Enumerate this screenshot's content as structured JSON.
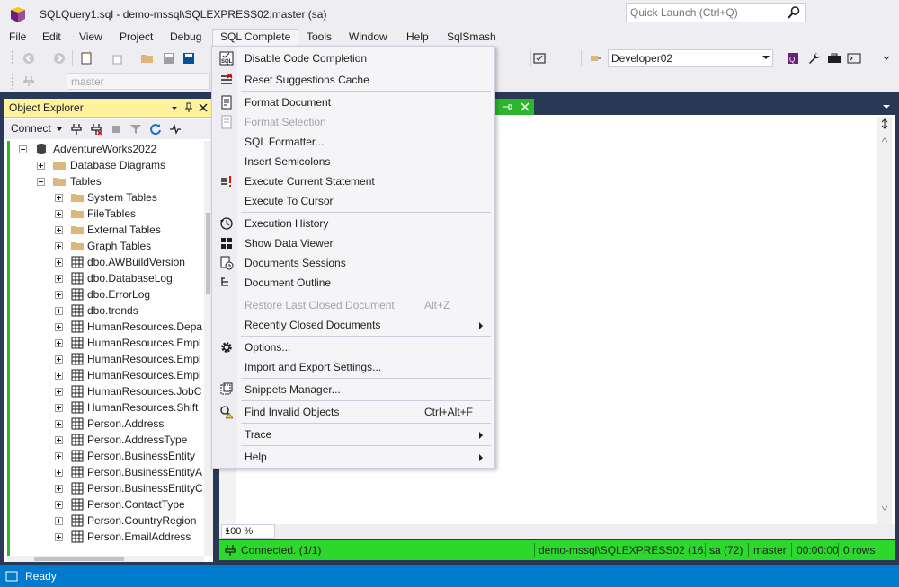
{
  "window": {
    "title": "SQLQuery1.sql - demo-mssql\\SQLEXPRESS02.master (sa)",
    "quick_launch_placeholder": "Quick Launch (Ctrl+Q)"
  },
  "menubar": {
    "items": [
      "File",
      "Edit",
      "View",
      "Project",
      "Debug",
      "SQL Complete",
      "Tools",
      "Window",
      "Help",
      "SqlSmash"
    ]
  },
  "toolbar": {
    "server_value": "Developer02",
    "database_value": "master"
  },
  "object_explorer": {
    "title": "Object Explorer",
    "connect_label": "Connect",
    "tree": [
      "AdventureWorks2022",
      "Database Diagrams",
      "Tables",
      "System Tables",
      "FileTables",
      "External Tables",
      "Graph Tables",
      "dbo.AWBuildVersion",
      "dbo.DatabaseLog",
      "dbo.ErrorLog",
      "dbo.trends",
      "HumanResources.Depa",
      "HumanResources.Empl",
      "HumanResources.Empl",
      "HumanResources.Empl",
      "HumanResources.JobC",
      "HumanResources.Shift",
      "Person.Address",
      "Person.AddressType",
      "Person.BusinessEntity",
      "Person.BusinessEntityA",
      "Person.BusinessEntityC",
      "Person.ContactType",
      "Person.CountryRegion",
      "Person.EmailAddress"
    ]
  },
  "sql_complete_menu": {
    "items": [
      {
        "label": "Disable Code Completion",
        "icon": "sql-icon",
        "shortcut": "",
        "submenu": false,
        "disabled": false
      },
      {
        "label": "Reset Suggestions Cache",
        "icon": "reset-cache-icon",
        "shortcut": "",
        "submenu": false,
        "disabled": false
      },
      {
        "label": "Format Document",
        "icon": "format-document-icon",
        "shortcut": "",
        "submenu": false,
        "disabled": false
      },
      {
        "label": "Format Selection",
        "icon": "format-selection-icon",
        "shortcut": "",
        "submenu": false,
        "disabled": true
      },
      {
        "label": "SQL Formatter...",
        "icon": "",
        "shortcut": "",
        "submenu": false,
        "disabled": false
      },
      {
        "label": "Insert Semicolons",
        "icon": "",
        "shortcut": "",
        "submenu": false,
        "disabled": false
      },
      {
        "label": "Execute Current Statement",
        "icon": "execute-statement-icon",
        "shortcut": "",
        "submenu": false,
        "disabled": false
      },
      {
        "label": "Execute To Cursor",
        "icon": "",
        "shortcut": "",
        "submenu": false,
        "disabled": false
      },
      {
        "label": "Execution History",
        "icon": "history-icon",
        "shortcut": "",
        "submenu": false,
        "disabled": false
      },
      {
        "label": "Show Data Viewer",
        "icon": "data-viewer-icon",
        "shortcut": "",
        "submenu": false,
        "disabled": false
      },
      {
        "label": "Documents Sessions",
        "icon": "sessions-icon",
        "shortcut": "",
        "submenu": false,
        "disabled": false
      },
      {
        "label": "Document Outline",
        "icon": "outline-icon",
        "shortcut": "",
        "submenu": false,
        "disabled": false
      },
      {
        "label": "Restore Last Closed Document",
        "icon": "",
        "shortcut": "Alt+Z",
        "submenu": false,
        "disabled": true
      },
      {
        "label": "Recently Closed Documents",
        "icon": "",
        "shortcut": "",
        "submenu": true,
        "disabled": false
      },
      {
        "label": "Options...",
        "icon": "gear-icon",
        "shortcut": "",
        "submenu": false,
        "disabled": false
      },
      {
        "label": "Import and Export Settings...",
        "icon": "",
        "shortcut": "",
        "submenu": false,
        "disabled": false
      },
      {
        "label": "Snippets Manager...",
        "icon": "snippets-icon",
        "shortcut": "",
        "submenu": false,
        "disabled": false
      },
      {
        "label": "Find Invalid Objects",
        "icon": "find-invalid-icon",
        "shortcut": "Ctrl+Alt+F",
        "submenu": false,
        "disabled": false
      },
      {
        "label": "Trace",
        "icon": "",
        "shortcut": "",
        "submenu": true,
        "disabled": false
      },
      {
        "label": "Help",
        "icon": "",
        "shortcut": "",
        "submenu": true,
        "disabled": false
      }
    ]
  },
  "editor": {
    "zoom": "100 %"
  },
  "query_status": {
    "connection": "Connected. (1/1)",
    "server": "demo-mssql\\SQLEXPRESS02 (16....",
    "user": "sa (72)",
    "database": "master",
    "elapsed": "00:00:00",
    "rows": "0 rows"
  },
  "statusbar": {
    "text": "Ready"
  },
  "colors": {
    "accent": "#007acc",
    "status_green": "#2dd82d",
    "dock_dark": "#293955",
    "oe_header": "#fff29d"
  }
}
